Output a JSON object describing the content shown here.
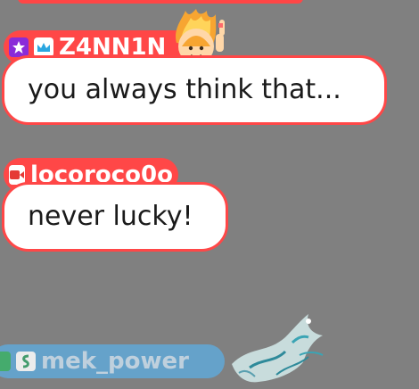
{
  "messages": [
    {
      "username": "Z4NN1N",
      "text": "you always think that...",
      "badges": [
        "star-badge",
        "crown-badge"
      ],
      "emote": "flaming-sprite-emote"
    },
    {
      "username": "locoroco0o",
      "text": "never lucky!",
      "badges": [
        "camera-badge"
      ]
    },
    {
      "username": "mek_power",
      "badges": [
        "green-badge",
        "serpent-badge"
      ]
    }
  ],
  "colors": {
    "background": "#808080",
    "bubble_border": "#ff4747",
    "tag_red": "#ff4747",
    "tag_blue": "#61a8d8"
  }
}
